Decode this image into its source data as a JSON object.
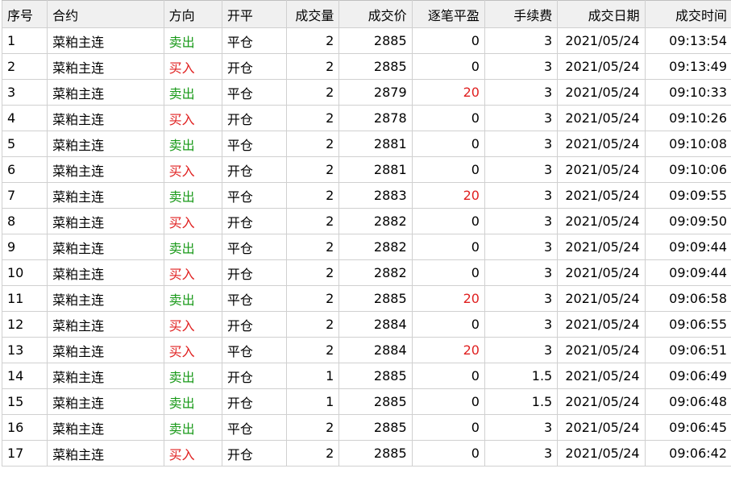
{
  "colors": {
    "buy": "#e02020",
    "sell": "#1a9a1a",
    "positive_pnl": "#e02020"
  },
  "columns": [
    "序号",
    "合约",
    "方向",
    "开平",
    "成交量",
    "成交价",
    "逐笔平盈",
    "手续费",
    "成交日期",
    "成交时间"
  ],
  "rows": [
    {
      "seq": "1",
      "contract": "菜粕主连",
      "side": "卖出",
      "side_type": "sell",
      "open_close": "平仓",
      "qty": "2",
      "price": "2885",
      "pnl": "0",
      "fee": "3",
      "date": "2021/05/24",
      "time": "09:13:54"
    },
    {
      "seq": "2",
      "contract": "菜粕主连",
      "side": "买入",
      "side_type": "buy",
      "open_close": "开仓",
      "qty": "2",
      "price": "2885",
      "pnl": "0",
      "fee": "3",
      "date": "2021/05/24",
      "time": "09:13:49"
    },
    {
      "seq": "3",
      "contract": "菜粕主连",
      "side": "卖出",
      "side_type": "sell",
      "open_close": "平仓",
      "qty": "2",
      "price": "2879",
      "pnl": "20",
      "fee": "3",
      "date": "2021/05/24",
      "time": "09:10:33"
    },
    {
      "seq": "4",
      "contract": "菜粕主连",
      "side": "买入",
      "side_type": "buy",
      "open_close": "开仓",
      "qty": "2",
      "price": "2878",
      "pnl": "0",
      "fee": "3",
      "date": "2021/05/24",
      "time": "09:10:26"
    },
    {
      "seq": "5",
      "contract": "菜粕主连",
      "side": "卖出",
      "side_type": "sell",
      "open_close": "平仓",
      "qty": "2",
      "price": "2881",
      "pnl": "0",
      "fee": "3",
      "date": "2021/05/24",
      "time": "09:10:08"
    },
    {
      "seq": "6",
      "contract": "菜粕主连",
      "side": "买入",
      "side_type": "buy",
      "open_close": "开仓",
      "qty": "2",
      "price": "2881",
      "pnl": "0",
      "fee": "3",
      "date": "2021/05/24",
      "time": "09:10:06"
    },
    {
      "seq": "7",
      "contract": "菜粕主连",
      "side": "卖出",
      "side_type": "sell",
      "open_close": "平仓",
      "qty": "2",
      "price": "2883",
      "pnl": "20",
      "fee": "3",
      "date": "2021/05/24",
      "time": "09:09:55"
    },
    {
      "seq": "8",
      "contract": "菜粕主连",
      "side": "买入",
      "side_type": "buy",
      "open_close": "开仓",
      "qty": "2",
      "price": "2882",
      "pnl": "0",
      "fee": "3",
      "date": "2021/05/24",
      "time": "09:09:50"
    },
    {
      "seq": "9",
      "contract": "菜粕主连",
      "side": "卖出",
      "side_type": "sell",
      "open_close": "平仓",
      "qty": "2",
      "price": "2882",
      "pnl": "0",
      "fee": "3",
      "date": "2021/05/24",
      "time": "09:09:44"
    },
    {
      "seq": "10",
      "contract": "菜粕主连",
      "side": "买入",
      "side_type": "buy",
      "open_close": "开仓",
      "qty": "2",
      "price": "2882",
      "pnl": "0",
      "fee": "3",
      "date": "2021/05/24",
      "time": "09:09:44"
    },
    {
      "seq": "11",
      "contract": "菜粕主连",
      "side": "卖出",
      "side_type": "sell",
      "open_close": "平仓",
      "qty": "2",
      "price": "2885",
      "pnl": "20",
      "fee": "3",
      "date": "2021/05/24",
      "time": "09:06:58"
    },
    {
      "seq": "12",
      "contract": "菜粕主连",
      "side": "买入",
      "side_type": "buy",
      "open_close": "开仓",
      "qty": "2",
      "price": "2884",
      "pnl": "0",
      "fee": "3",
      "date": "2021/05/24",
      "time": "09:06:55"
    },
    {
      "seq": "13",
      "contract": "菜粕主连",
      "side": "买入",
      "side_type": "buy",
      "open_close": "平仓",
      "qty": "2",
      "price": "2884",
      "pnl": "20",
      "fee": "3",
      "date": "2021/05/24",
      "time": "09:06:51"
    },
    {
      "seq": "14",
      "contract": "菜粕主连",
      "side": "卖出",
      "side_type": "sell",
      "open_close": "开仓",
      "qty": "1",
      "price": "2885",
      "pnl": "0",
      "fee": "1.5",
      "date": "2021/05/24",
      "time": "09:06:49"
    },
    {
      "seq": "15",
      "contract": "菜粕主连",
      "side": "卖出",
      "side_type": "sell",
      "open_close": "开仓",
      "qty": "1",
      "price": "2885",
      "pnl": "0",
      "fee": "1.5",
      "date": "2021/05/24",
      "time": "09:06:48"
    },
    {
      "seq": "16",
      "contract": "菜粕主连",
      "side": "卖出",
      "side_type": "sell",
      "open_close": "平仓",
      "qty": "2",
      "price": "2885",
      "pnl": "0",
      "fee": "3",
      "date": "2021/05/24",
      "time": "09:06:45"
    },
    {
      "seq": "17",
      "contract": "菜粕主连",
      "side": "买入",
      "side_type": "buy",
      "open_close": "开仓",
      "qty": "2",
      "price": "2885",
      "pnl": "0",
      "fee": "3",
      "date": "2021/05/24",
      "time": "09:06:42"
    }
  ]
}
